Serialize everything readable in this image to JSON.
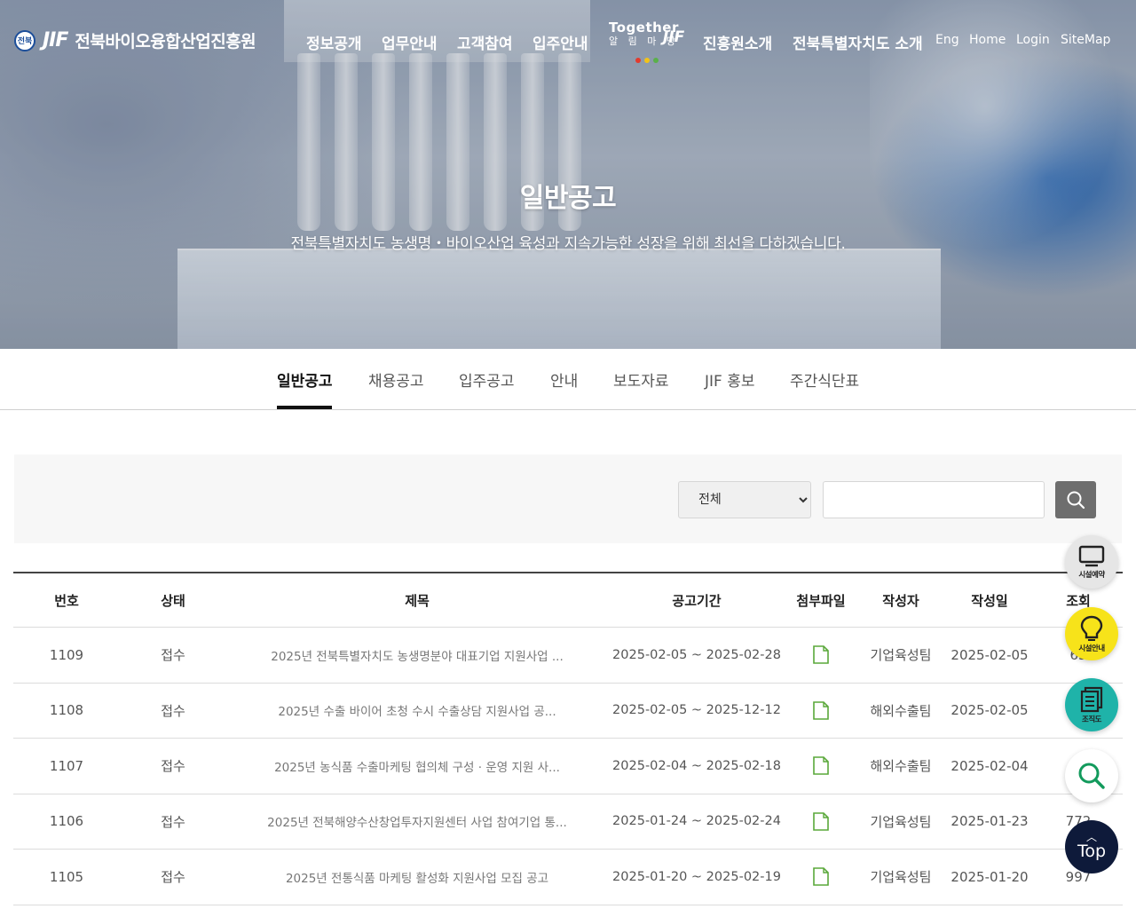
{
  "header": {
    "org_name": "전북바이오융합산업진흥원",
    "logo_jif": "JIF",
    "seal_text": "전북",
    "nav": [
      "정보공개",
      "업무안내",
      "고객참여",
      "입주안내",
      "진흥원소개",
      "전북특별자치도 소개"
    ],
    "together": {
      "line1": "Together",
      "line2": "알 림 마 당",
      "jif": "JIF"
    },
    "util_links": [
      "Eng",
      "Home",
      "Login",
      "SiteMap"
    ]
  },
  "hero": {
    "title": "일반공고",
    "subtitle": "전북특별자치도 농생명・바이오산업 육성과 지속가능한 성장을 위해 최선을 다하겠습니다."
  },
  "tabs": [
    "일반공고",
    "채용공고",
    "입주공고",
    "안내",
    "보도자료",
    "JIF 홍보",
    "주간식단표"
  ],
  "active_tab": "일반공고",
  "search": {
    "select_value": "전체",
    "input_value": ""
  },
  "table": {
    "headers": [
      "번호",
      "상태",
      "제목",
      "공고기간",
      "첨부파일",
      "작성자",
      "작성일",
      "조회"
    ],
    "rows": [
      {
        "num": "1109",
        "state": "접수",
        "title": "2025년 전북특별자치도 농생명분야 대표기업 지원사업 ...",
        "period": "2025-02-05 ~ 2025-02-28",
        "writer": "기업육성팀",
        "date": "2025-02-05",
        "views": "63"
      },
      {
        "num": "1108",
        "state": "접수",
        "title": "2025년 수출 바이어 초청 수시 수출상담 지원사업 공...",
        "period": "2025-02-05 ~ 2025-12-12",
        "writer": "해외수출팀",
        "date": "2025-02-05",
        "views": ""
      },
      {
        "num": "1107",
        "state": "접수",
        "title": "2025년 농식품 수출마케팅 협의체 구성 · 운영 지원 사...",
        "period": "2025-02-04 ~ 2025-02-18",
        "writer": "해외수출팀",
        "date": "2025-02-04",
        "views": ""
      },
      {
        "num": "1106",
        "state": "접수",
        "title": "2025년 전북해양수산창업투자지원센터 사업 참여기업 통...",
        "period": "2025-01-24 ~ 2025-02-24",
        "writer": "기업육성팀",
        "date": "2025-01-23",
        "views": "772"
      },
      {
        "num": "1105",
        "state": "접수",
        "title": "2025년 전통식품 마케팅 활성화 지원사업 모집 공고",
        "period": "2025-01-20 ~ 2025-02-19",
        "writer": "기업육성팀",
        "date": "2025-01-20",
        "views": "997"
      }
    ]
  },
  "quick_menu": [
    {
      "label": "시설예약",
      "icon": "monitor-icon",
      "color": "#e6e6e6"
    },
    {
      "label": "시설안내",
      "icon": "lightbulb-icon",
      "color": "#f7e31a"
    },
    {
      "label": "조직도",
      "icon": "document-icon",
      "color": "#1fb3a9"
    },
    {
      "label": "",
      "icon": "search-icon",
      "color": "#ffffff"
    }
  ],
  "top_button": "Top",
  "colors": {
    "file_icon": "#5aa83a",
    "top_btn": "#0e1a3a",
    "tab_active": "#111111"
  }
}
